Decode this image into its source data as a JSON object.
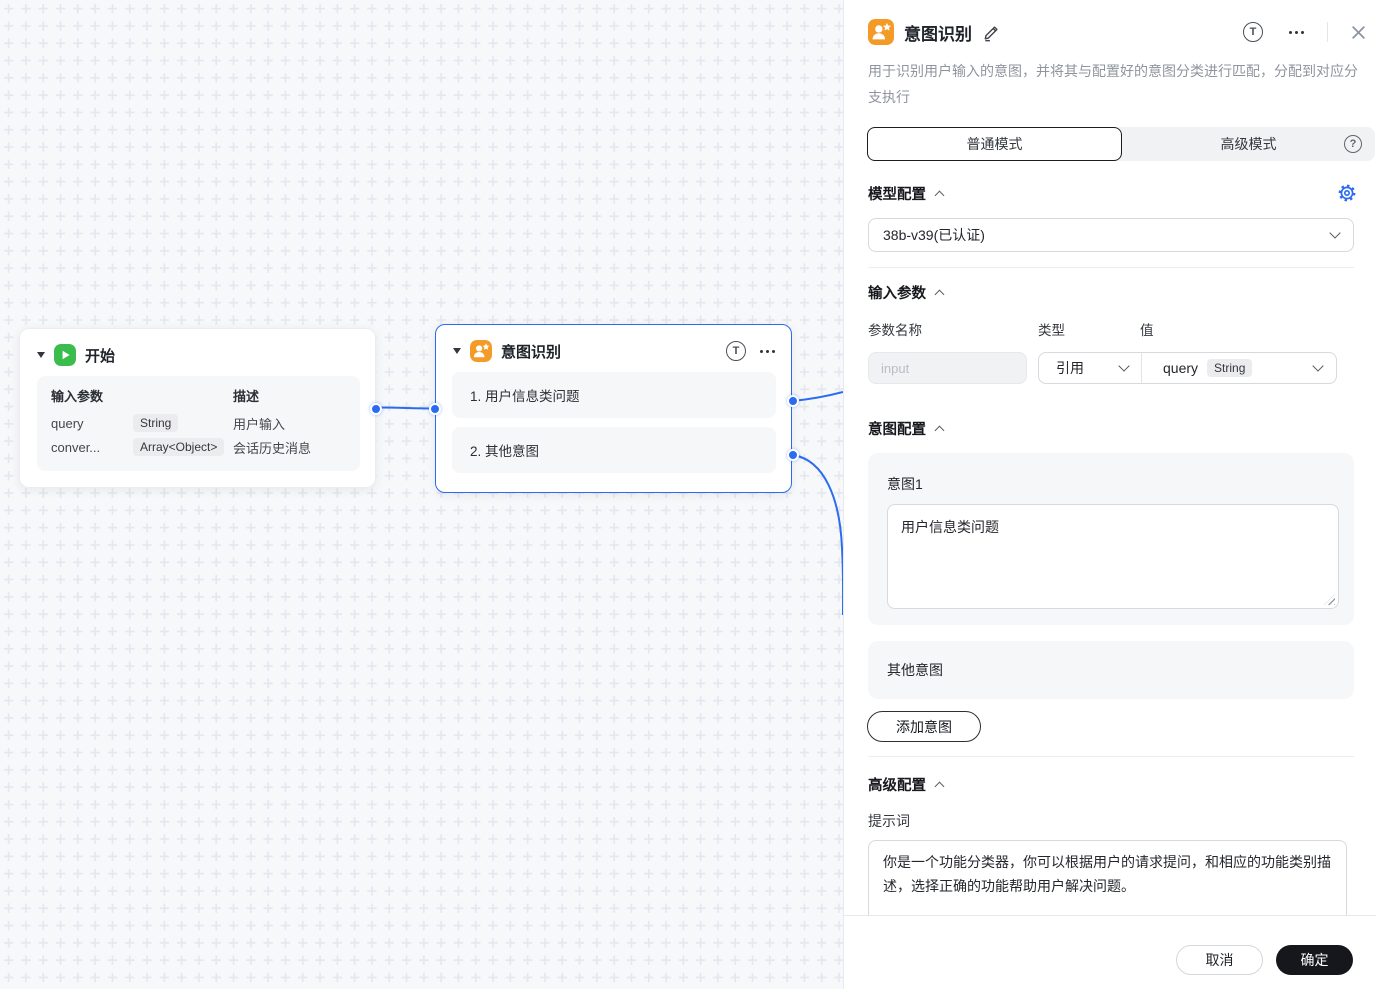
{
  "canvas": {
    "start_node": {
      "title": "开始",
      "columns": {
        "params": "输入参数",
        "desc": "描述"
      },
      "rows": [
        {
          "name": "query",
          "type": "String",
          "desc": "用户输入"
        },
        {
          "name": "conver...",
          "type": "Array<Object>",
          "desc": "会话历史消息"
        }
      ]
    },
    "intent_node": {
      "title": "意图识别",
      "items": [
        {
          "label": "1. 用户信息类问题"
        },
        {
          "label": "2. 其他意图"
        }
      ]
    }
  },
  "panel": {
    "title": "意图识别",
    "description": "用于识别用户输入的意图，并将其与配置好的意图分类进行匹配，分配到对应分支执行",
    "tabs": {
      "normal": "普通模式",
      "advanced": "高级模式"
    },
    "model_section": {
      "title": "模型配置",
      "selected_model": "38b-v39(已认证)"
    },
    "input_section": {
      "title": "输入参数",
      "col_name": "参数名称",
      "col_type": "类型",
      "col_value": "值",
      "row": {
        "name_placeholder": "input",
        "type_value": "引用",
        "value_name": "query",
        "value_type": "String"
      }
    },
    "intent_section": {
      "title": "意图配置",
      "intent1_label": "意图1",
      "intent1_value": "用户信息类问题",
      "other_label": "其他意图",
      "add_button": "添加意图"
    },
    "advanced_section": {
      "title": "高级配置",
      "prompt_label": "提示词",
      "prompt_value": "你是一个功能分类器，你可以根据用户的请求提问，和相应的功能类别描述，选择正确的功能帮助用户解决问题。"
    },
    "footer": {
      "cancel": "取消",
      "confirm": "确定"
    }
  },
  "icons": {
    "test_run_glyph": "T",
    "help_glyph": "?"
  },
  "colors": {
    "accent_blue": "#2B6BF2",
    "node_orange": "#F39B26",
    "node_green": "#3BBD4E",
    "confirm_black": "#15171C",
    "canvas_bg": "#F7F8FA",
    "grid_cross": "#E4E7EF",
    "card_gray": "#F6F7F8"
  }
}
